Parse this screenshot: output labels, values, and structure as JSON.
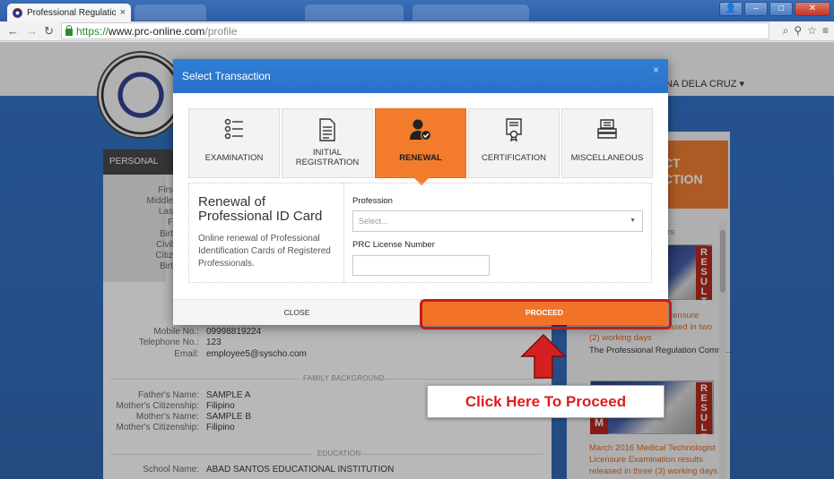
{
  "browser": {
    "tab_title": "Professional Regulation C",
    "tab_close": "×",
    "url_scheme": "https://",
    "url_host": "www.prc-online.com",
    "url_path": "/profile"
  },
  "page": {
    "user_menu": "NA DELA CRUZ ▾",
    "personal_data_label": "PERSONAL DATA",
    "partial_labels": [
      "Firs",
      "Middle",
      "Las",
      "F",
      "Birt",
      "Civil",
      "Citiz",
      "Birt"
    ],
    "contact": [
      {
        "key": "Mobile No.:",
        "value": "09998819224"
      },
      {
        "key": "Telephone No.:",
        "value": "123"
      },
      {
        "key": "Email:",
        "value": "employee5@syscho.com"
      }
    ],
    "family_label": "FAMILY BACKGROUND",
    "family": [
      {
        "key": "Father's Name:",
        "value": "SAMPLE A"
      },
      {
        "key": "Mother's Citizenship:",
        "value": "Filipino"
      },
      {
        "key": "Mother's Name:",
        "value": "SAMPLE B"
      },
      {
        "key": "Mother's Citizenship:",
        "value": "Filipino"
      }
    ],
    "education_label": "EDUCATION",
    "school": {
      "key": "School Name:",
      "value": "ABAD SANTOS EDUCATIONAL INSTITUTION"
    },
    "orange_block_text": "CT\nCTION",
    "announcements_label": "NTS",
    "result_letters": "RESULT",
    "news": [
      {
        "text": "Licensure",
        "color": "orange"
      },
      {
        "text": "ased in two",
        "color": "orange"
      },
      {
        "text": "(2) working days",
        "color": "orange"
      },
      {
        "text": "The Professional Regulation Commi...",
        "color": "dark"
      },
      {
        "text": "March 2016 Medical Technologist",
        "color": "orange"
      },
      {
        "text": "Licensure Examination results",
        "color": "orange"
      },
      {
        "text": "released in three (3) working days",
        "color": "orange"
      }
    ],
    "thumb_letter": "M"
  },
  "modal": {
    "title": "Select Transaction",
    "close_x": "×",
    "tiles": [
      {
        "label": "EXAMINATION",
        "icon": "list-icon",
        "active": false
      },
      {
        "label": "INITIAL REGISTRATION",
        "icon": "document-icon",
        "active": false
      },
      {
        "label": "RENEWAL",
        "icon": "user-check-icon",
        "active": true
      },
      {
        "label": "CERTIFICATION",
        "icon": "certificate-icon",
        "active": false
      },
      {
        "label": "MISCELLANEOUS",
        "icon": "stack-icon",
        "active": false
      }
    ],
    "detail_title": "Renewal of Professional ID Card",
    "detail_desc": "Online renewal of Professional Identification Cards of Registered Professionals.",
    "profession_label": "Profession",
    "profession_placeholder": "Select...",
    "license_label": "PRC License Number",
    "license_value": "",
    "close_label": "CLOSE",
    "proceed_label": "PROCEED"
  },
  "annotation": {
    "callout_text": "Click Here To Proceed",
    "highlight_color": "#c11c1c"
  },
  "colors": {
    "accent_orange": "#f27328",
    "header_blue": "#2f7fd6",
    "callout_red": "#d91f1f"
  }
}
